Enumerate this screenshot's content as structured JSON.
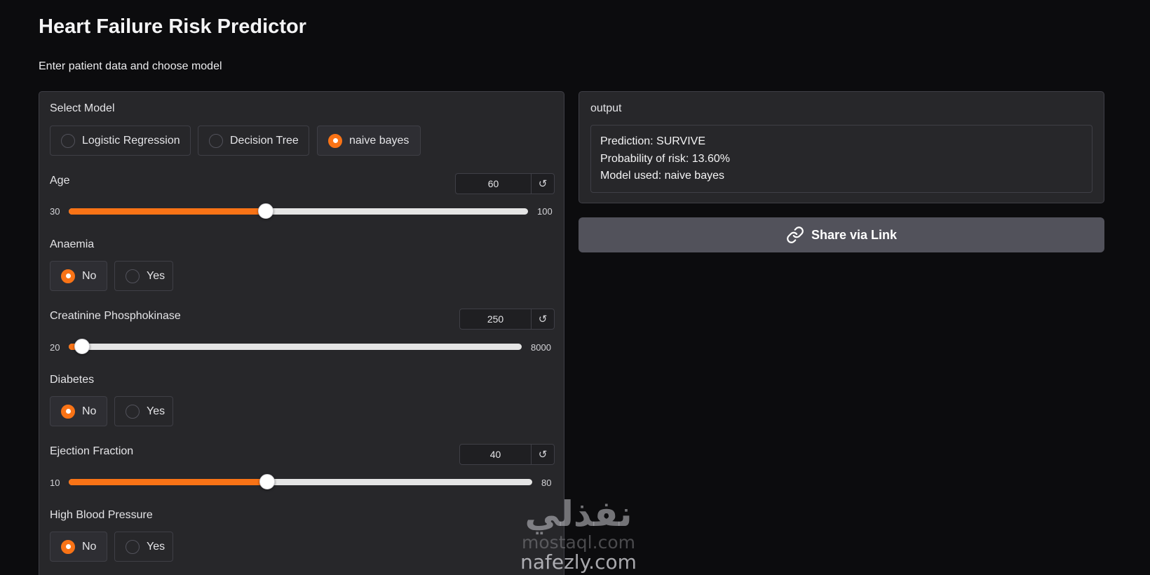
{
  "page": {
    "title": "Heart Failure Risk Predictor",
    "subtitle": "Enter patient data and choose model"
  },
  "colors": {
    "accent": "#f97316",
    "panel": "#27272a",
    "background": "#0c0c0e",
    "share_button": "#52525b"
  },
  "model_select": {
    "label": "Select Model",
    "options": [
      "Logistic Regression",
      "Decision Tree",
      "naive bayes"
    ],
    "selected": "naive bayes"
  },
  "age": {
    "label": "Age",
    "value": "60",
    "min": "30",
    "max": "100",
    "fraction": 0.4286
  },
  "anaemia": {
    "label": "Anaemia",
    "options": [
      "No",
      "Yes"
    ],
    "selected": "No"
  },
  "creatinine": {
    "label": "Creatinine Phosphokinase",
    "value": "250",
    "min": "20",
    "max": "8000",
    "fraction": 0.0288
  },
  "diabetes": {
    "label": "Diabetes",
    "options": [
      "No",
      "Yes"
    ],
    "selected": "No"
  },
  "ejection": {
    "label": "Ejection Fraction",
    "value": "40",
    "min": "10",
    "max": "80",
    "fraction": 0.4286
  },
  "high_bp": {
    "label": "High Blood Pressure",
    "options": [
      "No",
      "Yes"
    ],
    "selected": "No"
  },
  "output": {
    "label": "output",
    "lines": [
      "Prediction: SURVIVE",
      "Probability of risk: 13.60%",
      "Model used: naive bayes"
    ]
  },
  "share": {
    "label": "Share via Link",
    "icon": "link-icon"
  },
  "reset_icon": "↺",
  "watermark": {
    "logo": "نفذلي",
    "line1": "mostaql.com",
    "line2": "nafezly.com"
  }
}
